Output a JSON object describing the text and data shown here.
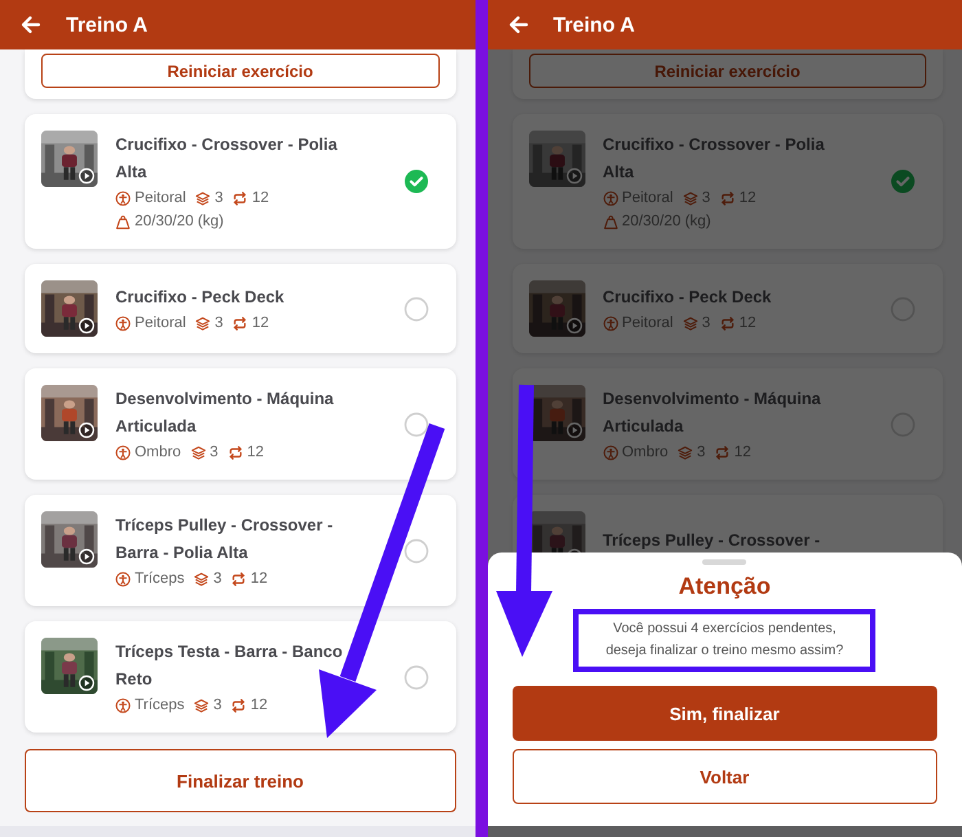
{
  "screens": [
    {
      "header": {
        "title": "Treino A"
      },
      "dimmed": false,
      "reset_button": "Reiniciar exercício",
      "exercises": [
        {
          "name": "Crucifixo - Crossover - Polia Alta",
          "muscle": "Peitoral",
          "sets": "3",
          "reps": "12",
          "load": "20/30/20 (kg)",
          "done": true
        },
        {
          "name": "Crucifixo - Peck Deck",
          "muscle": "Peitoral",
          "sets": "3",
          "reps": "12",
          "done": false
        },
        {
          "name": "Desenvolvimento - Máquina Articulada",
          "muscle": "Ombro",
          "sets": "3",
          "reps": "12",
          "done": false
        },
        {
          "name": "Tríceps Pulley - Crossover - Barra - Polia Alta",
          "muscle": "Tríceps",
          "sets": "3",
          "reps": "12",
          "done": false
        },
        {
          "name": "Tríceps Testa - Barra - Banco Reto",
          "muscle": "Tríceps",
          "sets": "3",
          "reps": "12",
          "done": false
        }
      ],
      "finish_button": "Finalizar treino"
    },
    {
      "header": {
        "title": "Treino A"
      },
      "dimmed": true,
      "reset_button": "Reiniciar exercício",
      "exercises": [
        {
          "name": "Crucifixo - Crossover - Polia Alta",
          "muscle": "Peitoral",
          "sets": "3",
          "reps": "12",
          "load": "20/30/20 (kg)",
          "done": true
        },
        {
          "name": "Crucifixo - Peck Deck",
          "muscle": "Peitoral",
          "sets": "3",
          "reps": "12",
          "done": false
        },
        {
          "name": "Desenvolvimento - Máquina Articulada",
          "muscle": "Ombro",
          "sets": "3",
          "reps": "12",
          "done": false
        },
        {
          "name": "Tríceps Pulley - Crossover -"
        }
      ],
      "dialog": {
        "title": "Atenção",
        "message": "Você possui 4 exercícios pendentes, deseja finalizar o treino mesmo assim?",
        "confirm_button": "Sim, finalizar",
        "cancel_button": "Voltar"
      }
    }
  ]
}
